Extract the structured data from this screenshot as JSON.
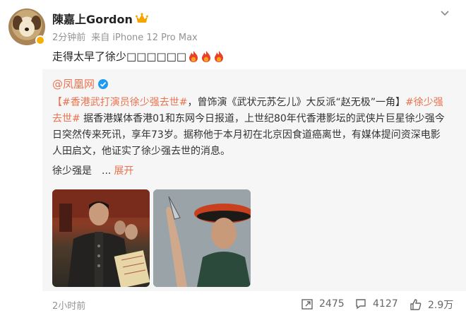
{
  "author": {
    "name": "陳嘉上Gordon",
    "time": "2分钟前",
    "source": "来自 iPhone 12 Pro Max"
  },
  "post_text": "走得太早了徐少□□□□□□",
  "repost": {
    "source_name": "@凤凰网",
    "tag1": "【#香港武打演员徐少强去世#",
    "text1": "，曾饰演《武状元苏乞儿》大反派“赵无极”一角】",
    "tag2": "#徐少强去世#",
    "text2": " 据香港媒体香港01和东网今日报道，上世纪80年代香港影坛的武侠片巨星徐少强今日突然传来死讯，享年73岁。据称他于本月初在北京因食道癌离世，有媒体提问资深电影人田启文，他证实了徐少强去世的消息。",
    "tail": "徐少强是　...",
    "expand": "展开"
  },
  "footer": {
    "time": "2小时前",
    "reposts": "2475",
    "comments": "4127",
    "likes": "2.9万"
  },
  "colors": {
    "accent": "#eb7350",
    "meta_gray": "#939393",
    "repost_bg": "#f6f6f6"
  }
}
